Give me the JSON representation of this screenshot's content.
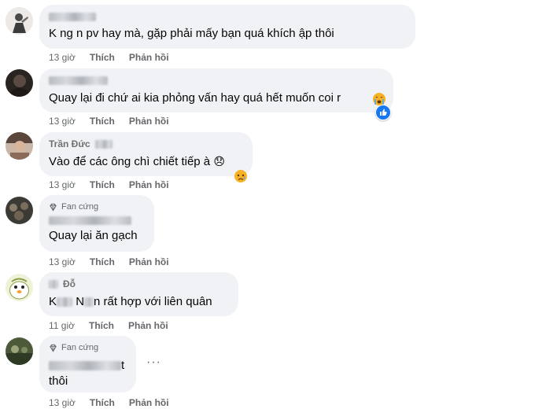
{
  "comments": [
    {
      "text": "K    ng     n pv hay mà, gặp phải mấy bạn quá khích       ập thôi",
      "time": "13 giờ",
      "like": "Thích",
      "reply": "Phản hồi"
    },
    {
      "text": "Quay lại đi chứ ai kia phỏng vấn hay quá hết muốn coi r",
      "time": "13 giờ",
      "like": "Thích",
      "reply": "Phản hồi",
      "reactions": [
        "crying-face",
        "like"
      ]
    },
    {
      "author": "Trần Đức",
      "text": "Vào để các ông chì chiết tiếp à",
      "emoji": "😞",
      "time": "13 giờ",
      "like": "Thích",
      "reply": "Phản hồi",
      "reactions": [
        "sad-face"
      ]
    },
    {
      "badge": "Fan cứng",
      "text": "Quay lại ăn gạch",
      "time": "13 giờ",
      "like": "Thích",
      "reply": "Phản hồi"
    },
    {
      "author": "Đỗ",
      "text_prefix": "K",
      "text_mid": "N",
      "text": "n rất hợp với liên quân",
      "time": "11 giờ",
      "like": "Thích",
      "reply": "Phản hồi"
    },
    {
      "badge": "Fan cứng",
      "text_end": "t",
      "text": "thôi",
      "time": "13 giờ",
      "like": "Thích",
      "reply": "Phản hồi",
      "more": "···"
    }
  ],
  "colors": {
    "bubble": "#f0f2f5",
    "meta": "#65676b",
    "like_blue": "#1877f2",
    "badge_icon": "#65676b"
  }
}
